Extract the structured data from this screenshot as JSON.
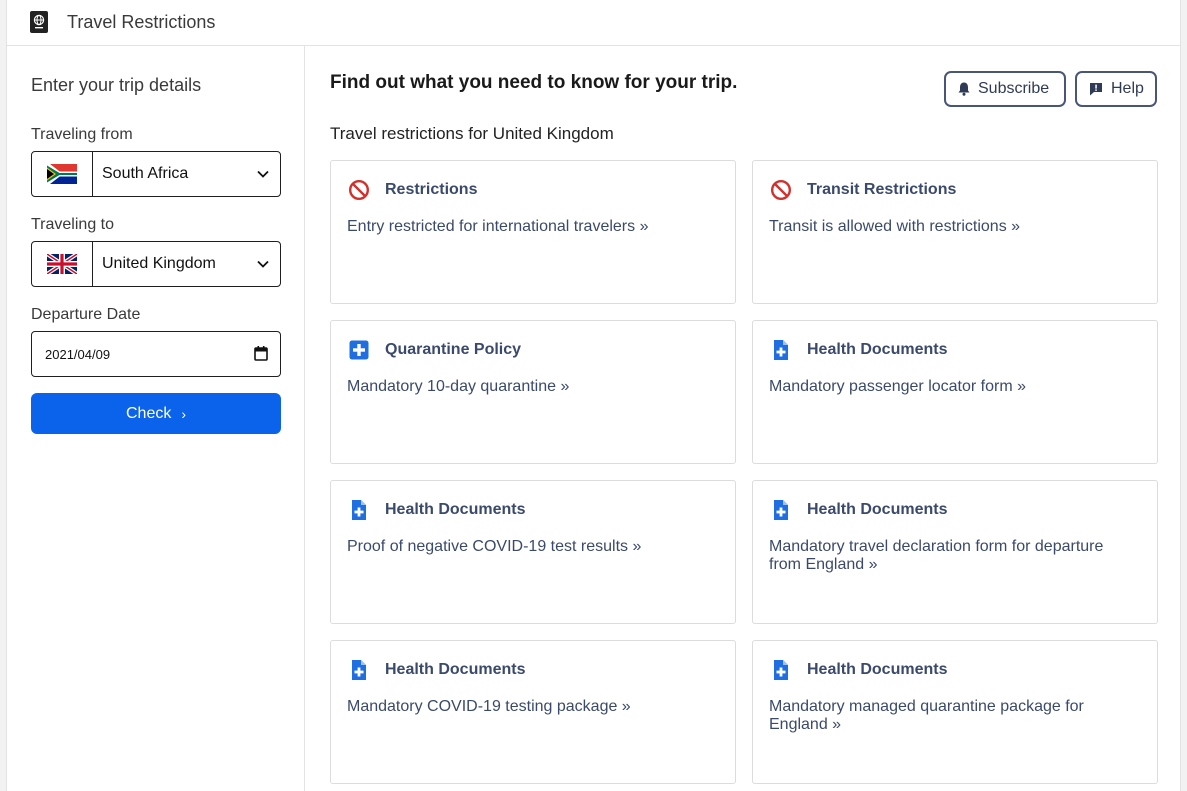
{
  "app": {
    "title": "Travel Restrictions",
    "icon": "passport-icon"
  },
  "sidebar": {
    "heading": "Enter your trip details",
    "from_label": "Traveling from",
    "from_value": "South Africa",
    "to_label": "Traveling to",
    "to_value": "United Kingdom",
    "date_label": "Departure Date",
    "date_value": "2021/04/09",
    "check_label": "Check",
    "check_arrow": "›"
  },
  "main": {
    "title": "Find out what you need to know for your trip.",
    "subscribe_label": "Subscribe",
    "help_label": "Help",
    "subtitle": "Travel restrictions for United Kingdom"
  },
  "cards": [
    {
      "icon": "no-entry-icon",
      "title": "Restrictions",
      "text": "Entry restricted for international travelers »"
    },
    {
      "icon": "no-entry-icon",
      "title": "Transit Restrictions",
      "text": "Transit is allowed with restrictions »"
    },
    {
      "icon": "medical-plus-icon",
      "title": "Quarantine Policy",
      "text": "Mandatory 10-day quarantine  »"
    },
    {
      "icon": "health-document-icon",
      "title": "Health Documents",
      "text": "Mandatory passenger locator form »"
    },
    {
      "icon": "health-document-icon",
      "title": "Health Documents",
      "text": "Proof of negative COVID-19 test results »"
    },
    {
      "icon": "health-document-icon",
      "title": "Health Documents",
      "text": "Mandatory travel declaration form for departure from England  »"
    },
    {
      "icon": "health-document-icon",
      "title": "Health Documents",
      "text": "Mandatory COVID-19 testing package »"
    },
    {
      "icon": "health-document-icon",
      "title": "Health Documents",
      "text": "Mandatory managed quarantine package for England »"
    }
  ],
  "colors": {
    "accent": "#0a63ea",
    "card_text": "#3b4a6b",
    "danger": "#d0312d",
    "icon_blue": "#1f6fe0"
  }
}
